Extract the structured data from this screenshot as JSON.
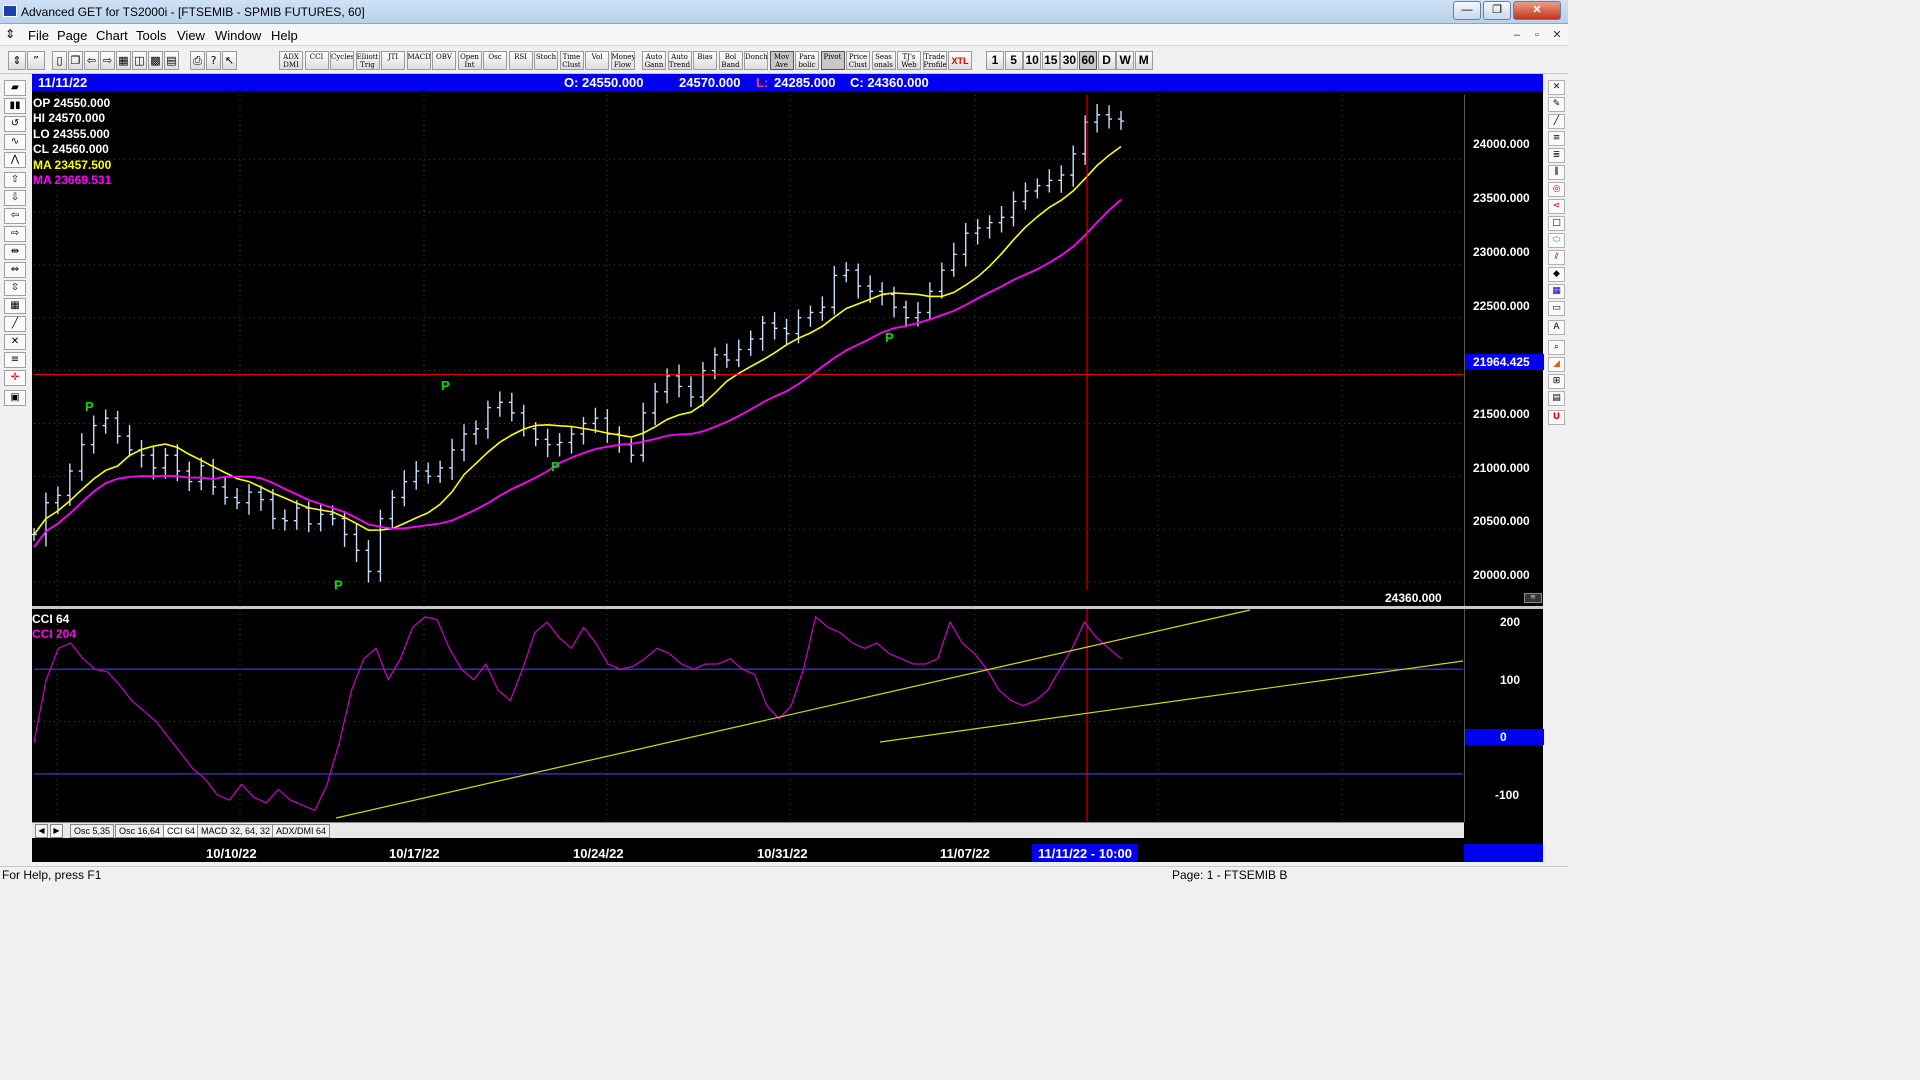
{
  "window": {
    "title": "Advanced GET for TS2000i - [FTSEMIB - SPMIB FUTURES, 60]",
    "minimize": "—",
    "restore": "❐",
    "close": "✕"
  },
  "menu": {
    "items": [
      "File",
      "Page",
      "Chart",
      "Tools",
      "View",
      "Window",
      "Help"
    ],
    "mdi_controls": [
      "–",
      "▫",
      "✕"
    ]
  },
  "toolbar": {
    "indicator_buttons": [
      "ADX DMI",
      "CCI",
      "Cycles",
      "Elliott Trig",
      "JTI",
      "MACD",
      "OBV",
      "Open Int",
      "Osc",
      "RSI",
      "Stoch",
      "Time Clust",
      "Vol",
      "Money Flow",
      "Auto Gann",
      "Auto Trend",
      "Bias",
      "Bol Band",
      "Donch",
      "Mov Ave",
      "Para bolic",
      "Pivot",
      "Price Clust",
      "Seas onals",
      "TJ's Web",
      "Trade Profile",
      "XTL"
    ],
    "interval_buttons": [
      "1",
      "5",
      "10",
      "15",
      "30",
      "60",
      "D",
      "W",
      "M"
    ],
    "selected_interval": "60"
  },
  "infobar": {
    "date": "11/11/22",
    "open": "O: 24550.000",
    "high": "24570.000",
    "low_label": "L:",
    "low": "24285.000",
    "close": "C: 24360.000"
  },
  "legend": {
    "op": "OP  24550.000",
    "hi": "HI   24570.000",
    "lo": "LO  24355.000",
    "cl": "CL  24560.000",
    "ma1": "MA  23457.500",
    "ma2": "MA  23669.531",
    "ma1_color": "#ffff00",
    "ma2_color": "#ff00ff"
  },
  "price_axis": {
    "labels": [
      "24000.000",
      "23500.000",
      "23000.000",
      "22500.000",
      "21500.000",
      "21000.000",
      "20500.000",
      "20000.000"
    ],
    "highlight": "21964.425",
    "last_price": "24360.000"
  },
  "indicator": {
    "name": "CCI 64",
    "value_label": "CCI  204",
    "axis_labels": [
      "200",
      "100",
      "0",
      "-100"
    ]
  },
  "pivot_label": "P",
  "tabs": [
    "Osc 5,35",
    "Osc 16,64",
    "CCI 64",
    "MACD 32, 64, 32",
    "ADX/DMI 64"
  ],
  "active_tab": "CCI 64",
  "date_axis": {
    "labels": [
      "10/10/22",
      "10/17/22",
      "10/24/22",
      "10/31/22",
      "11/07/22"
    ],
    "cursor": "11/11/22 - 10:00"
  },
  "status": {
    "help": "For Help, press F1",
    "page": "Page: 1 - FTSEMIB B"
  },
  "colors": {
    "bars": "#c8dcff",
    "ma_fast": "#ffff00",
    "ma_slow": "#ff00ff",
    "cci_line": "#cc00cc",
    "pivot": "#00e000",
    "cursor": "#ff0000",
    "infobar": "#0000f0"
  },
  "chart_data": {
    "type": "ohlc",
    "interval": "60",
    "series_colors": {
      "ma_fast": "#ffff00",
      "ma_slow": "#ff00ff"
    },
    "price_range": [
      19830,
      24560
    ],
    "cci_range": [
      -190,
      215
    ],
    "closes": [
      20450,
      20750,
      20820,
      21050,
      21300,
      21480,
      21550,
      21380,
      21250,
      21200,
      21080,
      21200,
      21050,
      20950,
      21100,
      20900,
      20800,
      20750,
      20850,
      20780,
      20600,
      20580,
      20700,
      20550,
      20640,
      20600,
      20450,
      20300,
      20100,
      20600,
      20800,
      20950,
      21050,
      21000,
      21080,
      21250,
      21400,
      21450,
      21650,
      21700,
      21600,
      21450,
      21350,
      21300,
      21320,
      21400,
      21500,
      21550,
      21400,
      21300,
      21200,
      21600,
      21800,
      21950,
      21850,
      21750,
      22000,
      22150,
      22100,
      22200,
      22300,
      22450,
      22400,
      22350,
      22500,
      22550,
      22600,
      22900,
      22950,
      22800,
      22750,
      22720,
      22600,
      22500,
      22550,
      22750,
      22950,
      23100,
      23300,
      23350,
      23400,
      23450,
      23600,
      23700,
      23750,
      23800,
      23850,
      24050,
      24350,
      24420,
      24380,
      24360
    ],
    "pivots": [
      {
        "x": "10/10/22",
        "price": 21560,
        "type": "high"
      },
      {
        "x": "10/13/22",
        "price": 20080,
        "type": "low"
      },
      {
        "x": "10/17/22",
        "price": 21760,
        "type": "high"
      },
      {
        "x": "10/24/22",
        "price": 21200,
        "type": "low"
      },
      {
        "x": "11/03/22",
        "price": 22420,
        "type": "low"
      }
    ],
    "cci_values": [
      -40,
      80,
      140,
      150,
      120,
      100,
      95,
      70,
      40,
      20,
      0,
      -30,
      -60,
      -90,
      -110,
      -140,
      -150,
      -120,
      -145,
      -155,
      -130,
      -150,
      -160,
      -170,
      -120,
      -40,
      60,
      120,
      140,
      80,
      120,
      180,
      200,
      195,
      140,
      100,
      80,
      110,
      60,
      40,
      100,
      170,
      190,
      160,
      140,
      180,
      150,
      110,
      100,
      105,
      120,
      140,
      130,
      110,
      100,
      110,
      110,
      120,
      100,
      90,
      30,
      5,
      30,
      100,
      200,
      180,
      170,
      150,
      140,
      150,
      130,
      120,
      110,
      110,
      120,
      190,
      150,
      130,
      100,
      60,
      40,
      30,
      40,
      60,
      100,
      140,
      190,
      160,
      140,
      120
    ],
    "horizontal_line": 21964.425,
    "cursor_x": "11/11/22 - 10:00"
  }
}
